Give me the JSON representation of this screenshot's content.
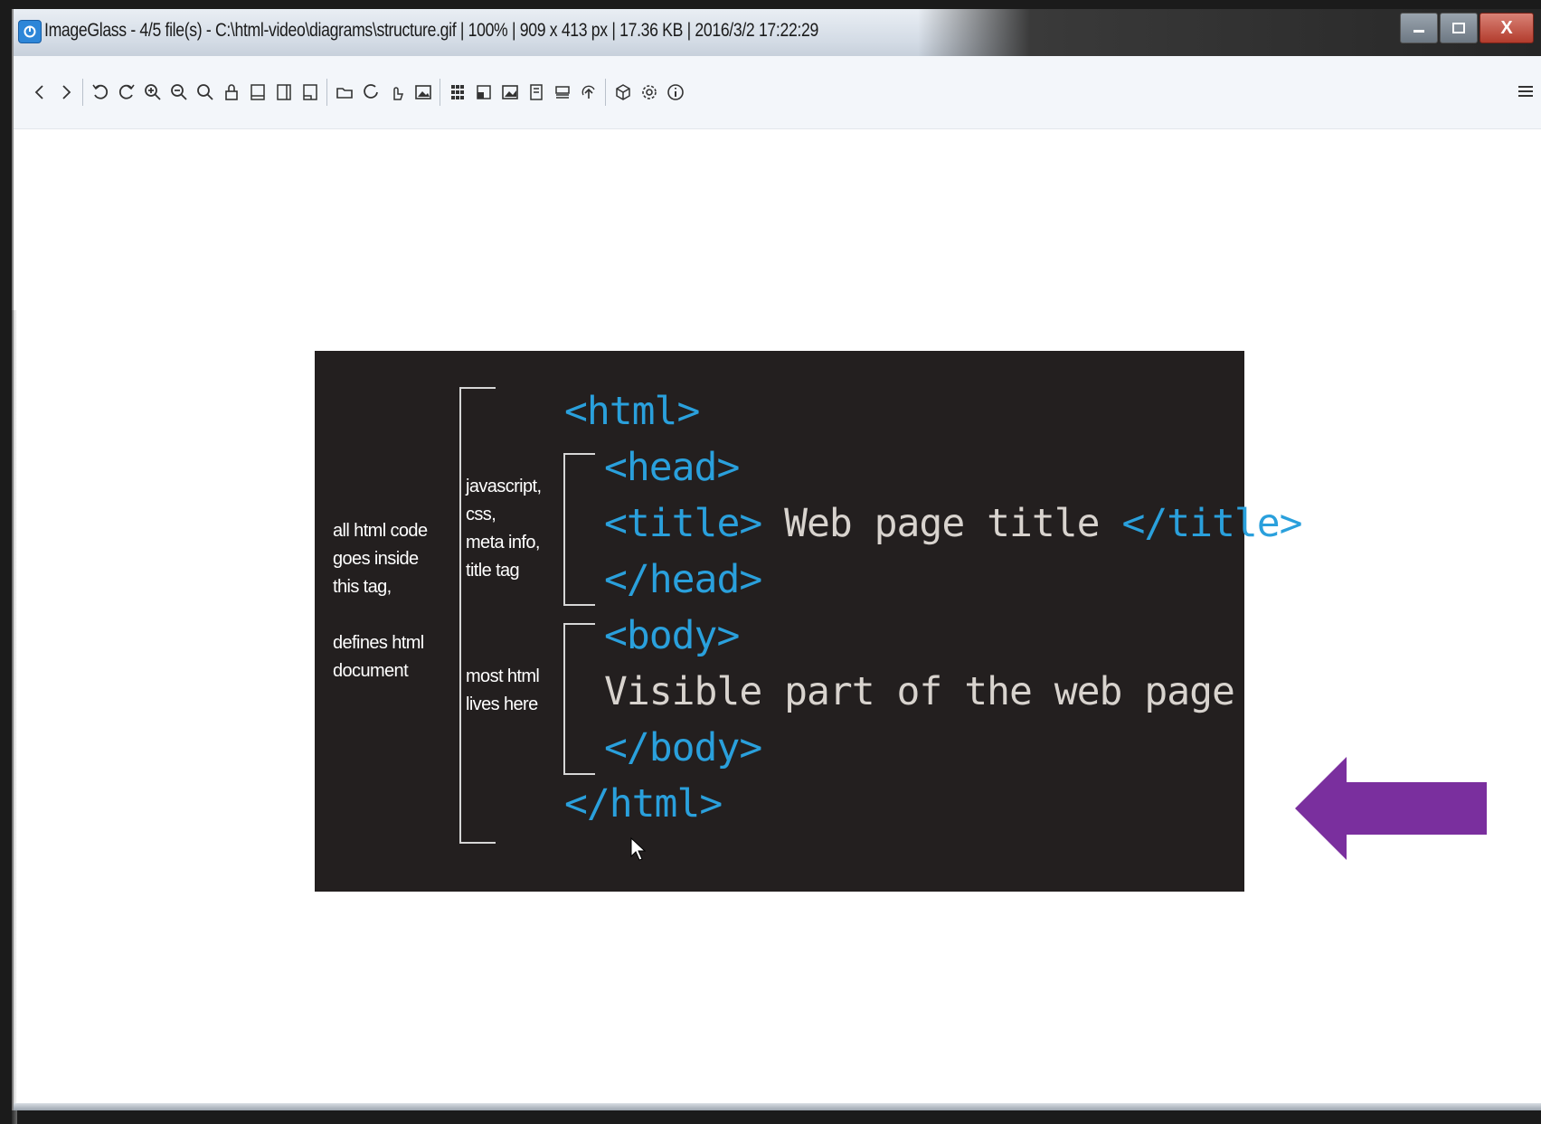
{
  "window": {
    "title": "ImageGlass - 4/5 file(s) - C:\\html-video\\diagrams\\structure.gif  |  100%  |  909 x 413 px  |  17.36 KB  |  2016/3/2 17:22:29",
    "controls": [
      "minimize",
      "maximize",
      "close"
    ],
    "close_glyph": "X"
  },
  "toolbar": {
    "icons": [
      "previous-icon",
      "next-icon",
      "rotate-left-icon",
      "rotate-right-icon",
      "zoom-in-icon",
      "zoom-out-icon",
      "actual-size-icon",
      "lock-zoom-icon",
      "fit-width-icon",
      "fit-height-icon",
      "scale-to-fit-icon",
      "open-file-icon",
      "refresh-icon",
      "go-to-icon",
      "gallery-icon",
      "thumbnail-bar-icon",
      "checkerboard-icon",
      "full-screen-icon",
      "slideshow-icon",
      "save-icon",
      "print-icon",
      "upload-icon",
      "plugins-icon",
      "settings-icon",
      "info-icon",
      "menu-icon"
    ]
  },
  "slide": {
    "left_notes": {
      "line1": "all html code",
      "line2": "goes inside",
      "line3": "this tag,",
      "line4": "defines html",
      "line5": "document"
    },
    "head_notes": {
      "line1": "javascript,",
      "line2": "css,",
      "line3": "meta info,",
      "line4": "title tag"
    },
    "body_notes": {
      "line1": "most html",
      "line2": "lives here"
    },
    "code": {
      "html_open": "<html>",
      "head_open": "<head>",
      "title_open": "<title>",
      "title_text": " Web page title ",
      "title_close": "</title>",
      "head_close": "</head>",
      "body_open": "<body>",
      "body_text": "Visible part of the web page",
      "body_close": "</body>",
      "html_close": "</html>"
    },
    "colors": {
      "background": "#231f1f",
      "tag": "#2aa0dc",
      "text": "#d8d3ce",
      "arrow": "#7a2f9e"
    }
  }
}
